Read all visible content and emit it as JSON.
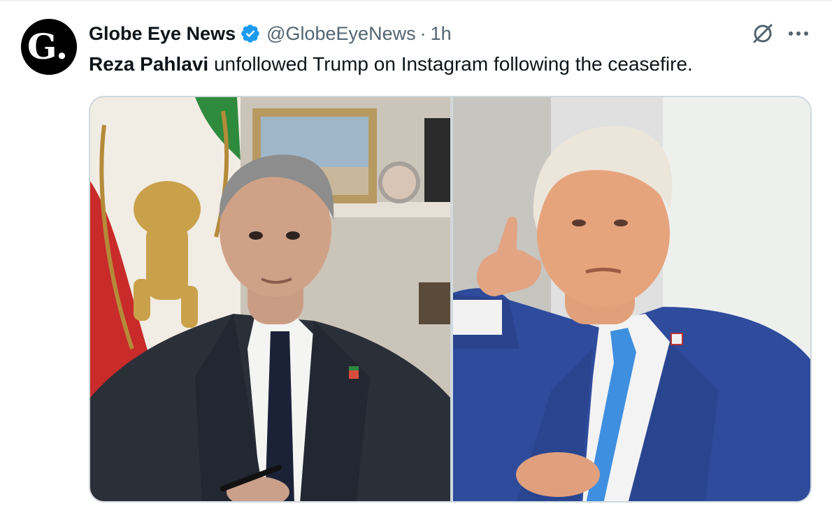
{
  "tweet": {
    "author": {
      "display_name": "Globe Eye News",
      "handle": "@GlobeEyeNews",
      "verified": true,
      "avatar_text": "G.",
      "avatar_icon": "globe-eye-logo"
    },
    "separator": "·",
    "timestamp": "1h",
    "text_bold": "Reza Pahlavi",
    "text_rest": " unfollowed Trump on Instagram following the ceasefire.",
    "icons": [
      "verified-badge-icon",
      "grok-icon",
      "more-options-icon"
    ],
    "media": [
      {
        "name": "photo-reza-pahlavi"
      },
      {
        "name": "photo-trump"
      }
    ]
  },
  "colors": {
    "primary_text": "#0f1419",
    "secondary_text": "#536471",
    "verified_blue": "#1d9bf0",
    "border": "#cfd9de"
  }
}
